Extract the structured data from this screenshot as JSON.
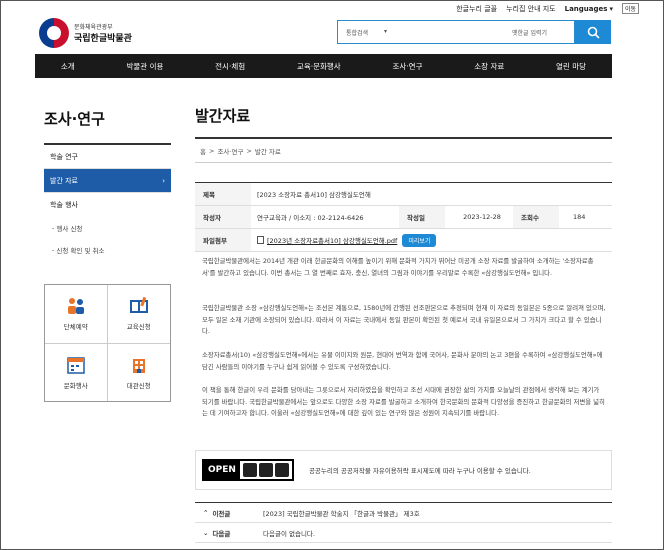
{
  "util": {
    "link1": "한글누리 글꼴",
    "link2": "누리집 안내 지도",
    "languages": "Languages",
    "login": "이동"
  },
  "logo": {
    "ministry": "문화체육관광부",
    "name": "국립한글박물관"
  },
  "search": {
    "scope": "통합검색",
    "placeholder": "",
    "keyboard": "옛한글 입력기"
  },
  "nav": [
    "소개",
    "박물관 이용",
    "전시·체험",
    "교육·문화행사",
    "조사·연구",
    "소장 자료",
    "열린 마당"
  ],
  "sidebar": {
    "title": "조사·연구",
    "items": [
      {
        "label": "학술 연구",
        "active": false
      },
      {
        "label": "발간 자료",
        "active": true
      },
      {
        "label": "학술 행사",
        "active": false
      }
    ],
    "subs": [
      "행사 신청",
      "신청 확인 및 취소"
    ]
  },
  "quick": [
    {
      "label": "단체예약",
      "icon": "group-reservation-icon"
    },
    {
      "label": "교육신청",
      "icon": "education-icon"
    },
    {
      "label": "문화행사",
      "icon": "calendar-icon"
    },
    {
      "label": "대관신청",
      "icon": "building-icon"
    }
  ],
  "page": {
    "title": "발간자료"
  },
  "breadcrumb": [
    "홈",
    "조사·연구",
    "발간 자료"
  ],
  "detail": {
    "title_label": "제목",
    "title": "[2023 소장자료 총서10] 삼강행실도언해",
    "author_label": "작성자",
    "author": "연구교육과 / 이소지 : 02-2124-6426",
    "date_label": "작성일",
    "date": "2023-12-28",
    "views_label": "조회수",
    "views": "184",
    "file_label": "파일첨부",
    "file": "[2023년 소장자료총서10] 삼강행실도언해.pdf",
    "preview": "미리보기"
  },
  "paragraphs": [
    "국립한글박물관에서는 2014년 개관 이래 한글문화의 이해를 높이기 위해 문화적 가치가 뛰어난 미공개 소장 자료를 발굴하여 소개하는 '소장자료총서'를 발간하고 있습니다. 이번 총서는 그 열 번째로 효자, 충신, 열녀의 그림과 이야기를 우리말로 수록한 «삼강행실도언해» 입니다.",
    "국립한글박물관 소장 «삼강행실도언해»는 조선본 계통으로, 1580년에 간행된 선조판본으로 추정되며 현재 이 자료의 동일본은 5종으로 알려져 있으며, 모두 일본 소재 기관에 소장되어 있습니다. 따라서 이 자료는 국내에서 동일 판본이 확인된 첫 예로서 국내 유일본으로서 그 가치가 크다고 할 수 있습니다.",
    "소장자료총서(10) «삼강행실도언해»에서는 유물 이미지와 원문, 현대어 번역과 함께 국어사, 문화사 분야의 논고 3편을 수록하여 «삼강행실도언해»에 담긴 사람들의 이야기를 누구나 쉽게 읽어볼 수 있도록 구성하였습니다.",
    "이 책을 통해 한글이 우리 문화를 담아내는 그릇으로서 자리하였음을 확인하고 조선 시대에 권장한 삶의 가치를 오늘날의 관점에서 생각해 보는 계기가 되기를 바랍니다. 국립한글박물관에서는 앞으로도 다양한 소장 자료를 발굴하고 소개하여 한국문화의 문화적 다양성을 증진하고 한글문화의 저변을 넓히는 데 기여하고자 합니다. 이울러 «삼강행실도언해»에 대한 깊이 있는 연구와 많은 성원이 지속되기를 바랍니다."
  ],
  "license": {
    "badge": "OPEN",
    "text": "공공누리의 공공저작물 자유이용허락 표시제도에 따라 누구나 이용할 수 있습니다."
  },
  "prevnext": {
    "prev_label": "이전글",
    "prev": "[2023] 국립한글박물관 학술지 「한글과 박물관」 제3호",
    "next_label": "다음글",
    "next": "다음글이 없습니다."
  }
}
